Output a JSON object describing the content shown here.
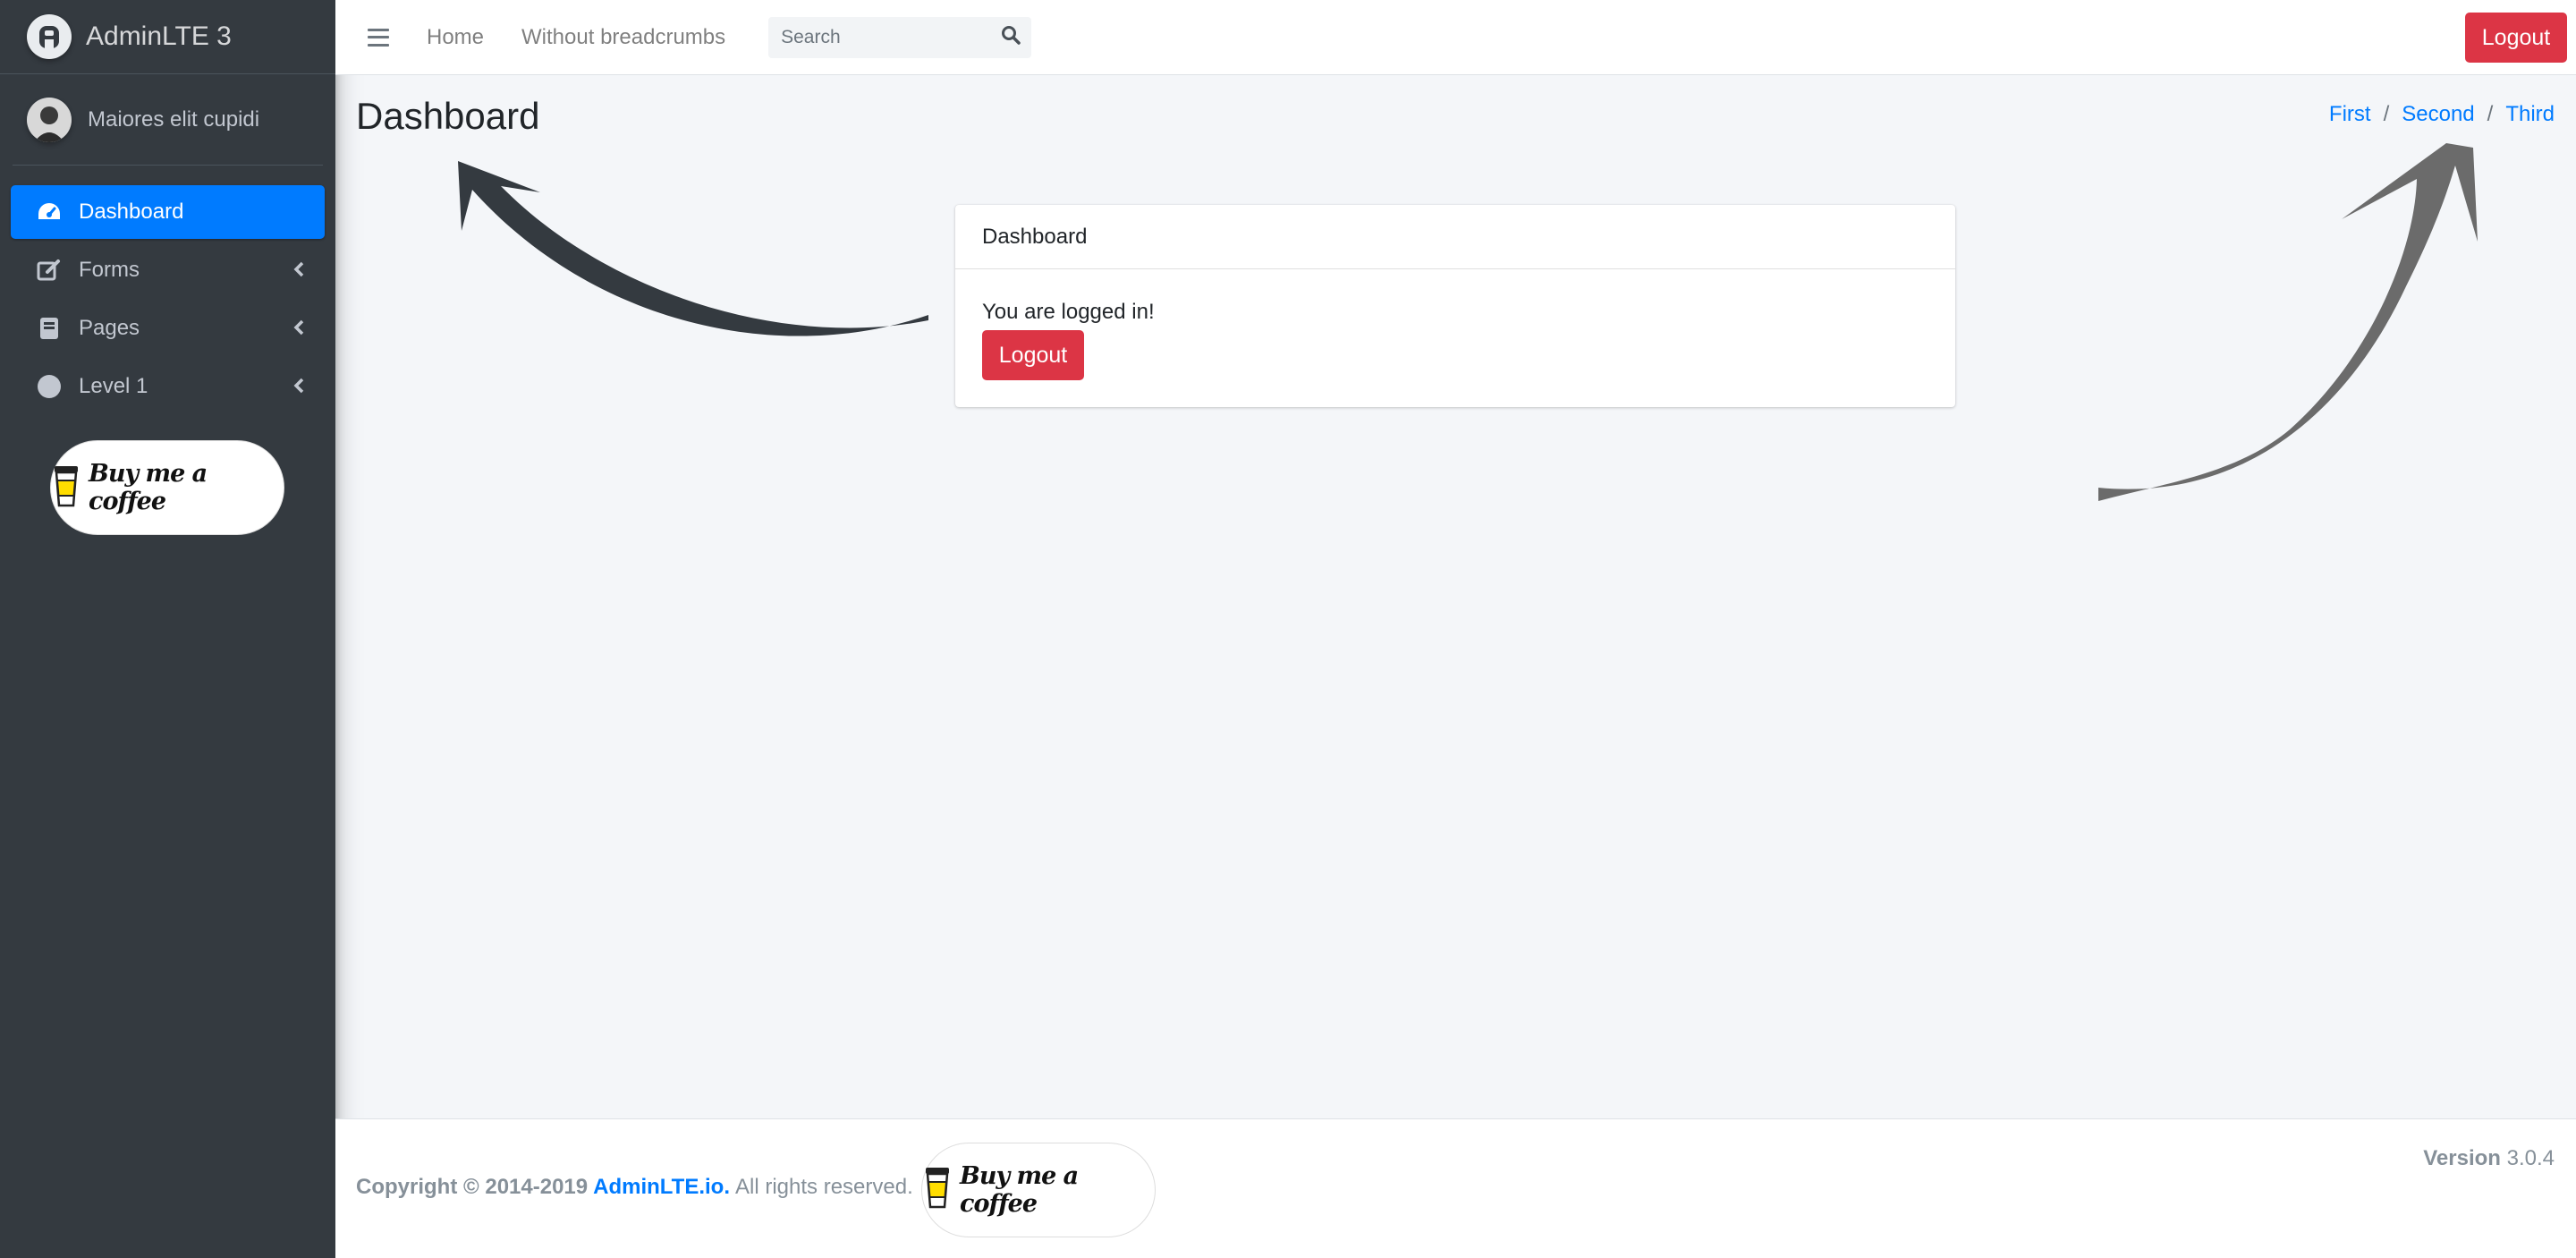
{
  "brand": {
    "name": "AdminLTE 3"
  },
  "user": {
    "name": "Maiores elit cupidi"
  },
  "sidebar": {
    "items": [
      {
        "label": "Dashboard",
        "icon": "tachometer-icon",
        "active": true
      },
      {
        "label": "Forms",
        "icon": "edit-icon"
      },
      {
        "label": "Pages",
        "icon": "book-icon"
      },
      {
        "label": "Level 1",
        "icon": "circle-icon"
      }
    ],
    "coffee_label": "Buy me a coffee"
  },
  "topbar": {
    "links": [
      "Home",
      "Without breadcrumbs"
    ],
    "search_placeholder": "Search",
    "logout_label": "Logout"
  },
  "page": {
    "title": "Dashboard",
    "breadcrumb": [
      "First",
      "Second",
      "Third"
    ]
  },
  "card": {
    "header": "Dashboard",
    "text": "You are logged in!",
    "logout_label": "Logout"
  },
  "footer": {
    "copyright": "Copyright © 2014-2019",
    "link": "AdminLTE.io.",
    "rights": "All rights reserved.",
    "coffee_label": "Buy me a coffee",
    "version_label": "Version",
    "version": "3.0.4"
  },
  "colors": {
    "accent": "#007bff",
    "danger": "#dc3545",
    "sidebar": "#343a40",
    "background": "#f4f6f9"
  }
}
